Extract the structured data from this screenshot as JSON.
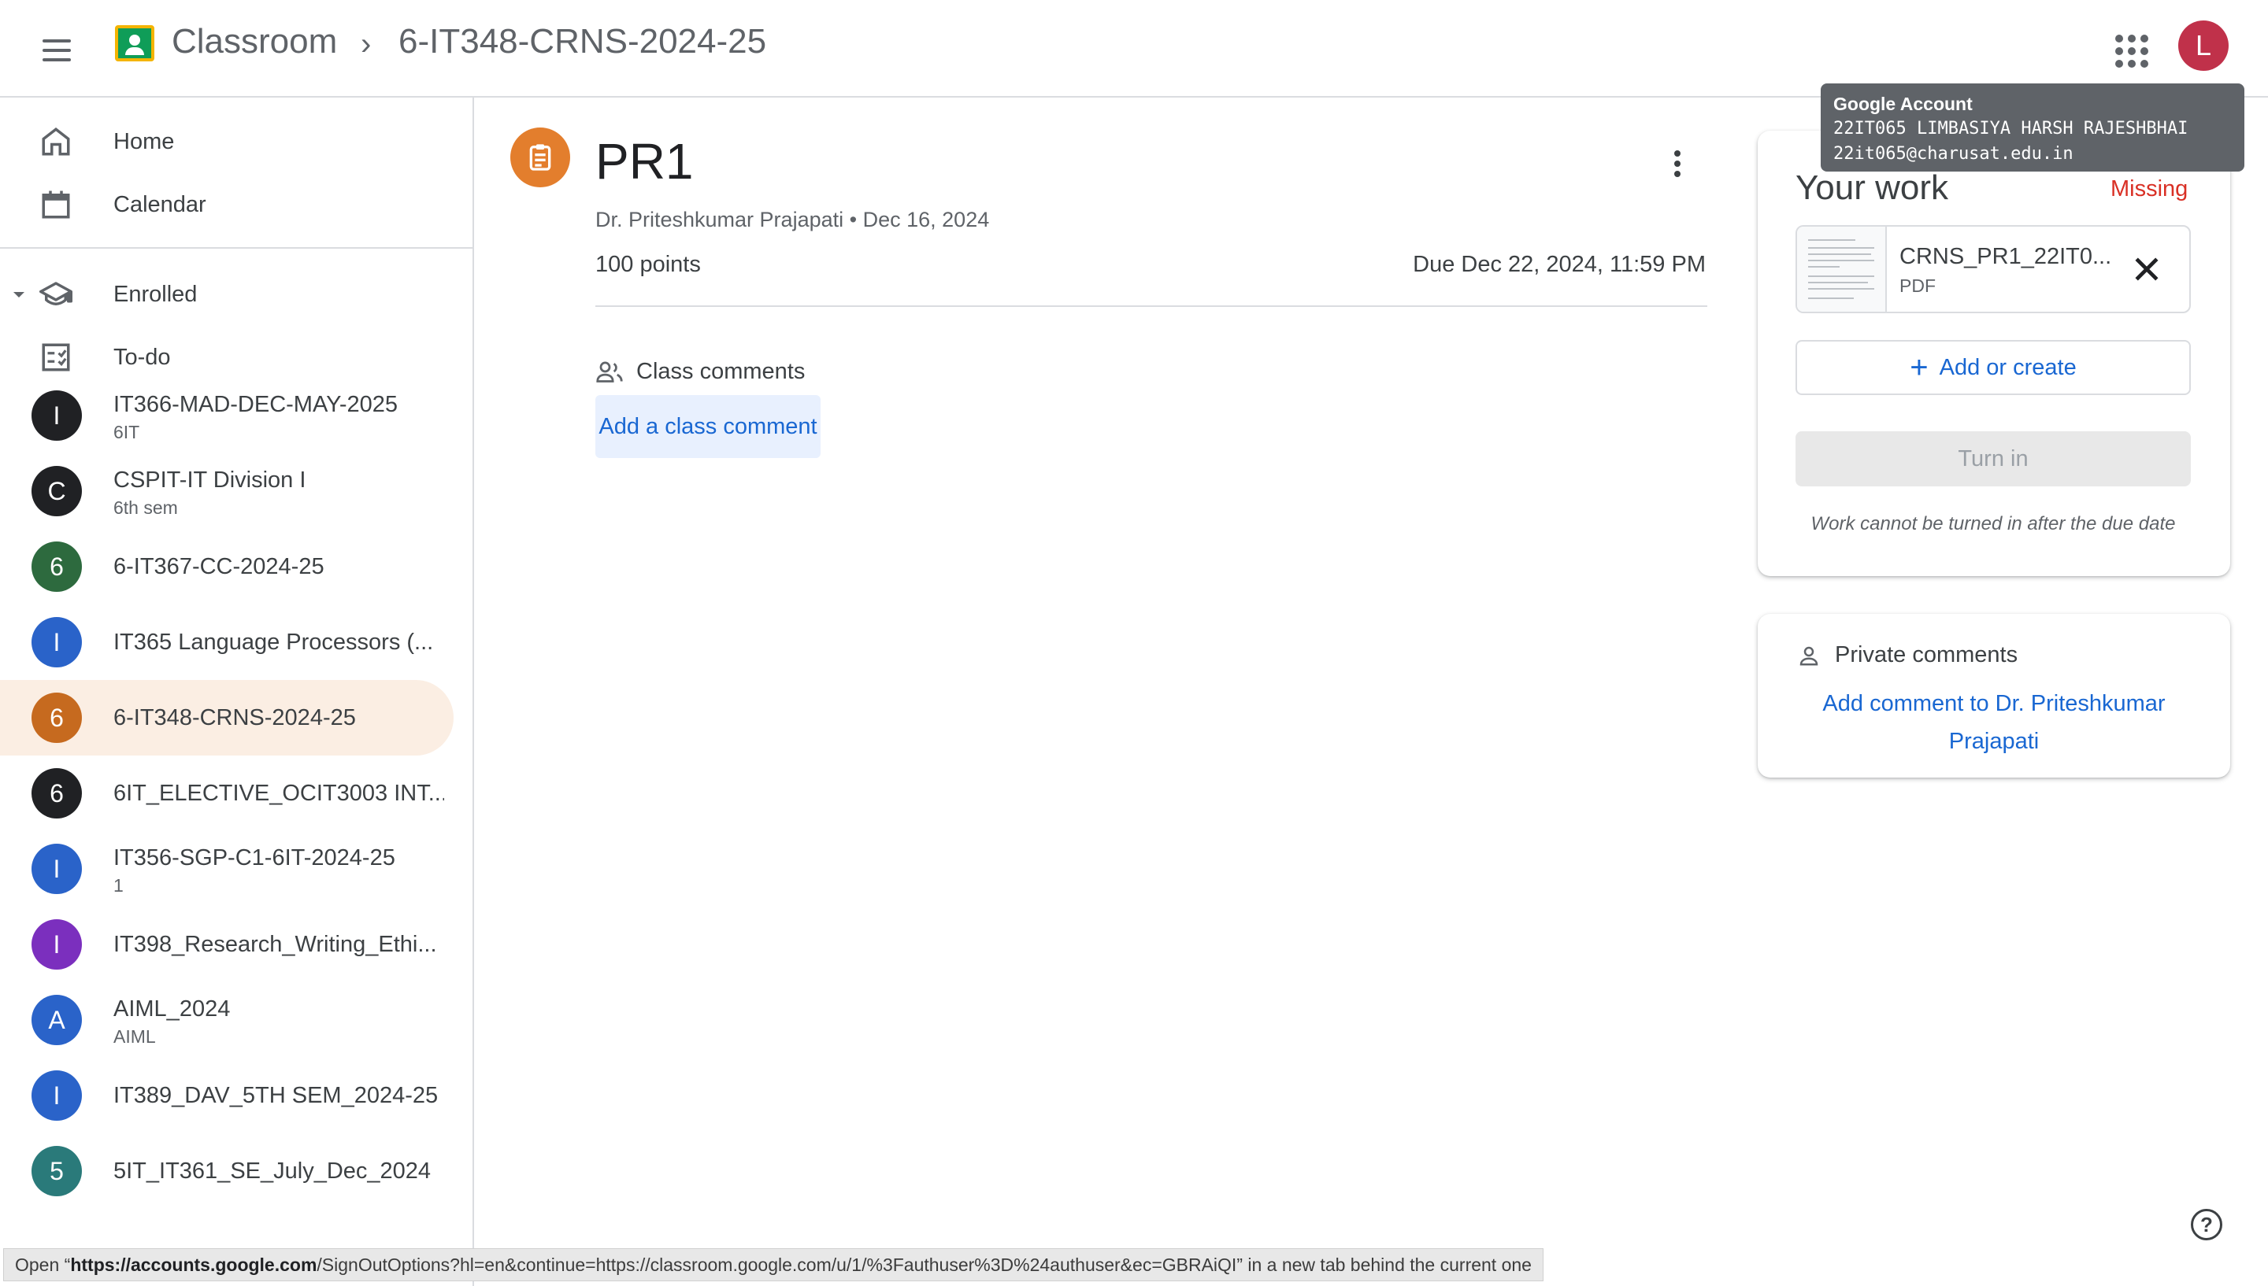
{
  "header": {
    "app_name": "Classroom",
    "breadcrumb_separator": "›",
    "course_name": "6-IT348-CRNS-2024-25",
    "avatar_initial": "L"
  },
  "tooltip": {
    "title": "Google Account",
    "name": "22IT065 LIMBASIYA HARSH RAJESHBHAI",
    "email": "22it065@charusat.edu.in"
  },
  "sidebar": {
    "home": "Home",
    "calendar": "Calendar",
    "enrolled": "Enrolled",
    "todo": "To-do",
    "courses": [
      {
        "initial": "I",
        "name": "IT366-MAD-DEC-MAY-2025",
        "sub": "6IT",
        "color": "#202124"
      },
      {
        "initial": "C",
        "name": "CSPIT-IT Division I",
        "sub": "6th sem",
        "color": "#202124"
      },
      {
        "initial": "6",
        "name": "6-IT367-CC-2024-25",
        "sub": "",
        "color": "#2d6a3e"
      },
      {
        "initial": "I",
        "name": "IT365 Language Processors (...",
        "sub": "",
        "color": "#2a63c9"
      },
      {
        "initial": "6",
        "name": "6-IT348-CRNS-2024-25",
        "sub": "",
        "color": "#c66a1f"
      },
      {
        "initial": "6",
        "name": "6IT_ELECTIVE_OCIT3003 INT...",
        "sub": "",
        "color": "#202124"
      },
      {
        "initial": "I",
        "name": "IT356-SGP-C1-6IT-2024-25",
        "sub": "1",
        "color": "#2a63c9"
      },
      {
        "initial": "I",
        "name": "IT398_Research_Writing_Ethi...",
        "sub": "",
        "color": "#7b2fbe"
      },
      {
        "initial": "A",
        "name": "AIML_2024",
        "sub": "AIML",
        "color": "#2a63c9"
      },
      {
        "initial": "I",
        "name": "IT389_DAV_5TH SEM_2024-25",
        "sub": "",
        "color": "#2a63c9"
      },
      {
        "initial": "5",
        "name": "5IT_IT361_SE_July_Dec_2024",
        "sub": "",
        "color": "#2a7a7a"
      }
    ]
  },
  "assignment": {
    "title": "PR1",
    "author": "Dr. Priteshkumar Prajapati",
    "date": "Dec 16, 2024",
    "meta_separator": "•",
    "points": "100 points",
    "due": "Due Dec 22, 2024, 11:59 PM",
    "class_comments_label": "Class comments",
    "add_class_comment": "Add a class comment"
  },
  "your_work": {
    "title": "Your work",
    "status": "Missing",
    "attachment_name": "CRNS_PR1_22IT0...",
    "attachment_type": "PDF",
    "add_or_create": "Add or create",
    "turn_in": "Turn in",
    "note": "Work cannot be turned in after the due date"
  },
  "private_comments": {
    "label": "Private comments",
    "link": "Add comment to Dr. Priteshkumar Prajapati"
  },
  "help_icon": "?",
  "status_bar": {
    "prefix": "Open “",
    "url_host": "https://accounts.google.com",
    "url_rest": "/SignOutOptions?hl=en&continue=https://classroom.google.com/u/1/%3Fauthuser%3D%24authuser&ec=GBRAiQI",
    "suffix": "” in a new tab behind the current one"
  },
  "colors": {
    "accent_blue": "#1967d2",
    "missing_red": "#d93025",
    "assignment_orange": "#e37e2d",
    "active_course_bg": "#fbeee3"
  }
}
